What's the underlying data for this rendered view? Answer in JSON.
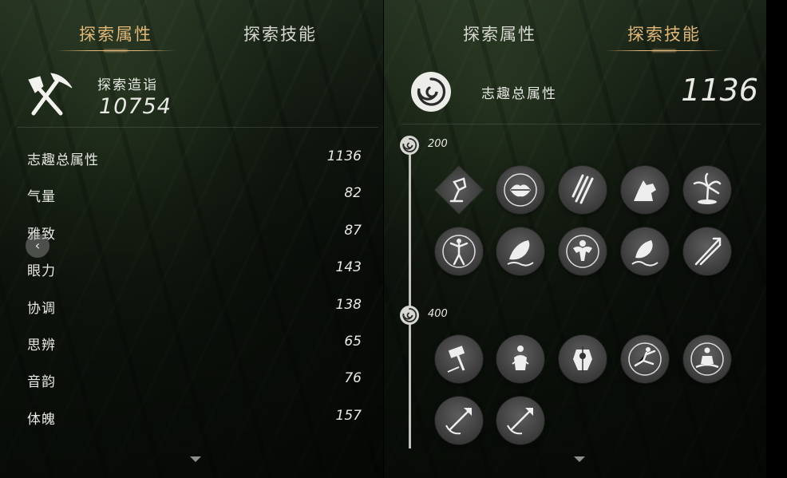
{
  "left_panel": {
    "tabs": [
      {
        "label": "探索属性",
        "active": true
      },
      {
        "label": "探索技能",
        "active": false
      }
    ],
    "header": {
      "label": "探索造诣",
      "value": "10754",
      "icon": "pickaxe-shovel-icon"
    },
    "attributes": [
      {
        "name": "志趣总属性",
        "value": "1136"
      },
      {
        "name": "气量",
        "value": "82"
      },
      {
        "name": "雅致",
        "value": "87"
      },
      {
        "name": "眼力",
        "value": "143"
      },
      {
        "name": "协调",
        "value": "138"
      },
      {
        "name": "思辨",
        "value": "65"
      },
      {
        "name": "音韵",
        "value": "76"
      },
      {
        "name": "体魄",
        "value": "157"
      }
    ],
    "back_icon": "chevron-left-icon",
    "scroll_icon": "chevron-down-icon"
  },
  "right_panel": {
    "tabs": [
      {
        "label": "探索属性",
        "active": false
      },
      {
        "label": "探索技能",
        "active": true
      }
    ],
    "header": {
      "label": "志趣总属性",
      "value": "1136",
      "icon": "swirl-icon"
    },
    "tiers": [
      {
        "threshold": "200",
        "skills": [
          "water-pour-icon",
          "lips-icon",
          "bamboo-icon",
          "wolf-icon",
          "palm-tree-icon",
          "dancer-icon",
          "fish-icon",
          "strongman-icon",
          "fish-leap-icon",
          "arrows-icon"
        ]
      },
      {
        "threshold": "400",
        "skills": [
          "hammer-icon",
          "praying-figure-icon",
          "armored-warrior-icon",
          "kick-icon",
          "meditation-icon",
          "arrow-hit-icon",
          "arrow-hit-2-icon"
        ]
      }
    ],
    "scroll_icon": "chevron-down-icon"
  },
  "colors": {
    "accent_gold": "#e1b878",
    "text": "#e8e8e4",
    "skill_bg": "#3c3c3c"
  }
}
